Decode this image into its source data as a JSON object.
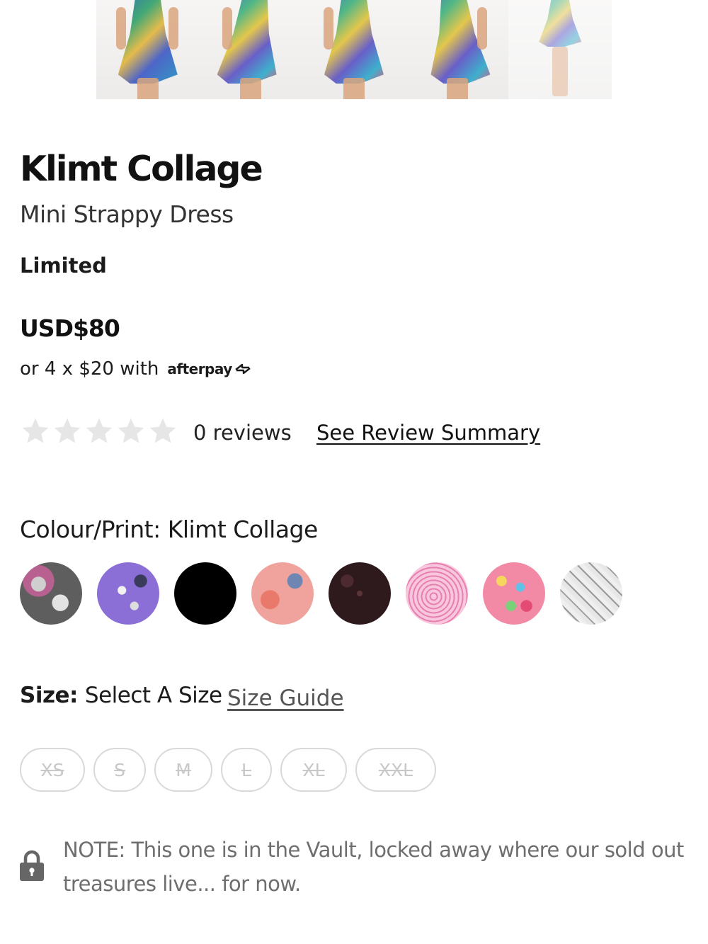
{
  "gallery": {
    "thumbnail_count": 5
  },
  "product": {
    "name": "Klimt Collage",
    "subtitle": "Mini Strappy Dress",
    "badge": "Limited",
    "price": "USD$80",
    "installments_text": "or 4 x $20 with",
    "installments_provider": "afterpay"
  },
  "reviews": {
    "rating": 0,
    "max_rating": 5,
    "count_text": "0 reviews",
    "summary_link": "See Review Summary"
  },
  "colour": {
    "label": "Colour/Print: Klimt Collage",
    "swatch_count": 8
  },
  "size": {
    "label": "Size:",
    "value": "Select A Size",
    "guide_link": "Size Guide",
    "options": [
      "XS",
      "S",
      "M",
      "L",
      "XL",
      "XXL"
    ],
    "all_sold_out": true
  },
  "note": {
    "icon": "lock-icon",
    "text": "NOTE: This one is in the Vault, locked away where our sold out treasures live... for now."
  },
  "colors": {
    "text": "#1b1b1b",
    "muted_text": "#6e6e6e",
    "star_empty": "#e6e6e6",
    "disabled_border": "#d9d9d9"
  }
}
